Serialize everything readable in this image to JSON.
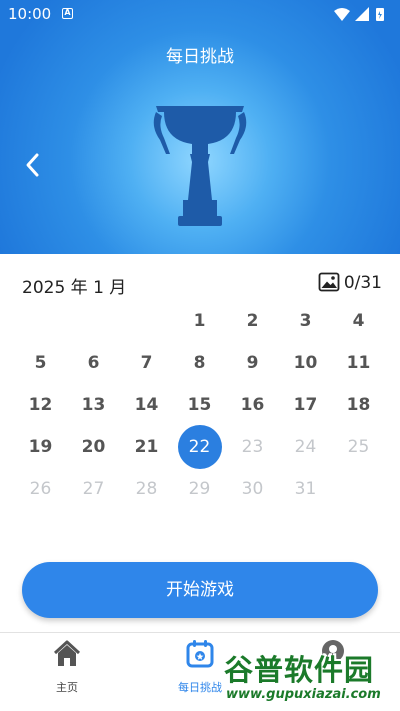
{
  "status_bar": {
    "time": "10:00",
    "notification_glyph": "A",
    "icons": [
      "wifi-icon",
      "signal-icon",
      "battery-charging-icon"
    ]
  },
  "header": {
    "title": "每日挑战",
    "back_icon": "chevron-left-icon",
    "illustration": "trophy-icon"
  },
  "calendar": {
    "month_label": "2025 年 1 月",
    "image_icon": "image-icon",
    "progress": "0/31",
    "leading_blank_days": 3,
    "today": "22",
    "days": [
      "1",
      "2",
      "3",
      "4",
      "5",
      "6",
      "7",
      "8",
      "9",
      "10",
      "11",
      "12",
      "13",
      "14",
      "15",
      "16",
      "17",
      "18",
      "19",
      "20",
      "21",
      "22",
      "23",
      "24",
      "25",
      "26",
      "27",
      "28",
      "29",
      "30",
      "31"
    ]
  },
  "start_button": {
    "label": "开始游戏"
  },
  "tab_bar": {
    "tabs": [
      {
        "label": "主页",
        "icon": "home-icon",
        "active": false
      },
      {
        "label": "每日挑战",
        "icon": "calendar-icon",
        "active": true
      },
      {
        "label": "",
        "icon": "profile-icon",
        "active": false
      }
    ]
  },
  "watermark": {
    "text": "谷普软件园",
    "url": "www.gupuxiazai.com"
  },
  "colors": {
    "accent": "#2f86ea",
    "header_blue": "#1f78db",
    "trophy": "#1e5ba8",
    "future_day": "#c4c7cb"
  }
}
